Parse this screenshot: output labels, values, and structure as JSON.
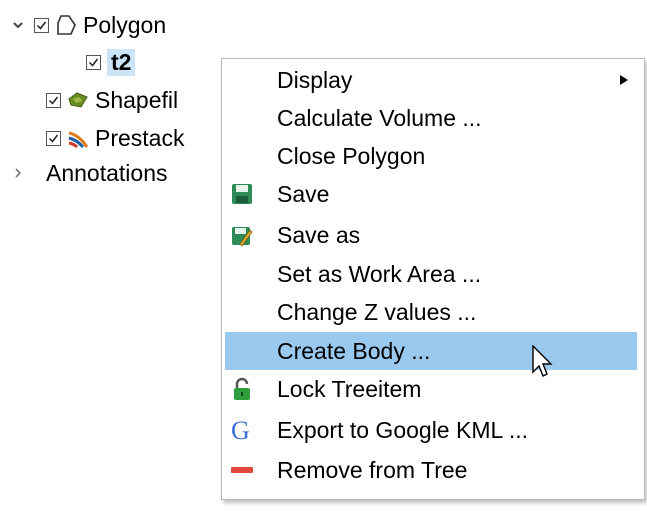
{
  "tree": {
    "polygon_label": "Polygon",
    "t2_label": "t2",
    "shapefile_label": "Shapefil",
    "prestack_label": "Prestack",
    "annotations_label": "Annotations"
  },
  "context_menu": {
    "items": [
      {
        "label": "Display",
        "icon": "",
        "has_submenu": true
      },
      {
        "label": "Calculate Volume ...",
        "icon": ""
      },
      {
        "label": "Close Polygon",
        "icon": ""
      },
      {
        "label": "Save",
        "icon": "save-icon"
      },
      {
        "label": "Save as",
        "icon": "save-as-icon"
      },
      {
        "label": "Set as Work Area ...",
        "icon": ""
      },
      {
        "label": "Change Z values ...",
        "icon": ""
      },
      {
        "label": "Create Body ...",
        "icon": "",
        "highlighted": true
      },
      {
        "label": "Lock Treeitem",
        "icon": "lock-icon"
      },
      {
        "label": "Export to Google KML ...",
        "icon": "google-icon"
      },
      {
        "label": "Remove from Tree",
        "icon": "remove-icon"
      }
    ]
  },
  "colors": {
    "highlight": "#99c9ef",
    "selected_item": "#cce4f7",
    "remove": "#e2483b",
    "save": "#2e8b57",
    "google_blue": "#3b6fd6"
  }
}
